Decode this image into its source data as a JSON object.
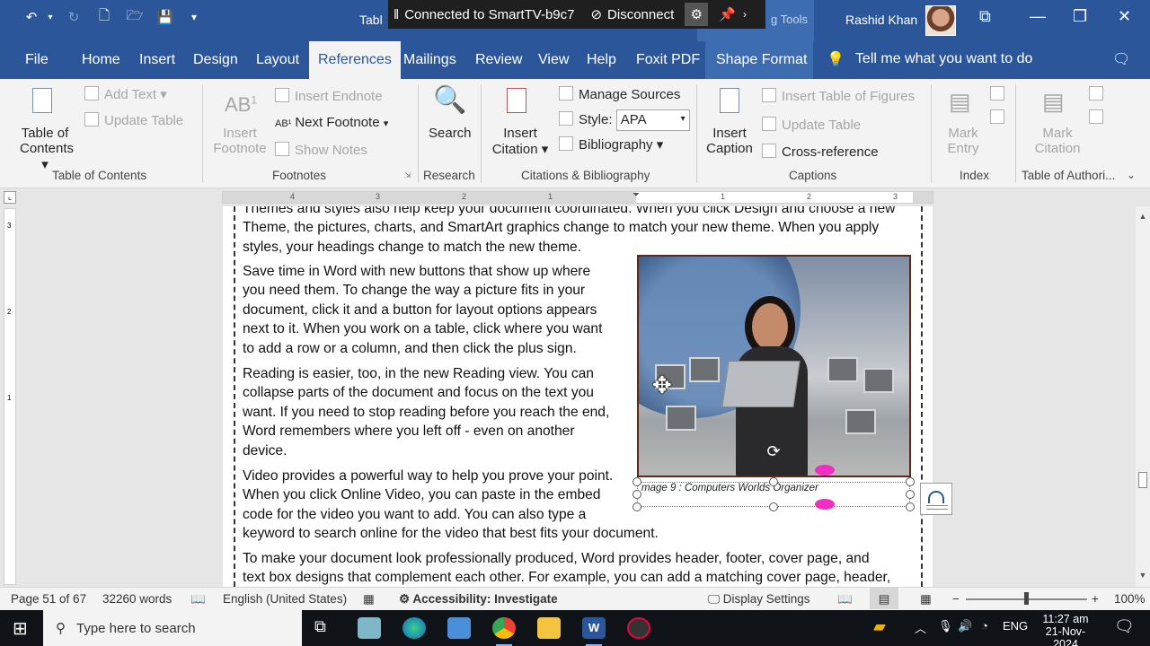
{
  "titlebar": {
    "title_partial": "Tabl",
    "cast": {
      "status": "Connected to SmartTV-b9c7",
      "disconnect": "Disconnect"
    },
    "context_group": "g Tools",
    "user": "Rashid Khan"
  },
  "tabs": [
    "File",
    "Home",
    "Insert",
    "Design",
    "Layout",
    "References",
    "Mailings",
    "Review",
    "View",
    "Help",
    "Foxit PDF",
    "Shape Format"
  ],
  "active_tab": "References",
  "tell_me": "Tell me what you want to do",
  "ribbon": {
    "toc": {
      "table_of_contents": "Table of",
      "table_of_contents_2": "Contents",
      "add_text": "Add Text",
      "update_table": "Update Table",
      "group": "Table of Contents"
    },
    "footnotes": {
      "ab_icon": "AB",
      "insert_footnote": "Insert",
      "insert_footnote_2": "Footnote",
      "insert_endnote": "Insert Endnote",
      "next_footnote": "Next Footnote",
      "show_notes": "Show Notes",
      "group": "Footnotes"
    },
    "research": {
      "search": "Search",
      "group": "Research"
    },
    "citations": {
      "insert_citation": "Insert",
      "insert_citation_2": "Citation",
      "manage_sources": "Manage Sources",
      "style_label": "Style:",
      "style_value": "APA",
      "bibliography": "Bibliography",
      "group": "Citations & Bibliography"
    },
    "captions": {
      "insert_caption": "Insert",
      "insert_caption_2": "Caption",
      "insert_table_of_figures": "Insert Table of Figures",
      "update_table": "Update Table",
      "cross_reference": "Cross-reference",
      "group": "Captions"
    },
    "index": {
      "mark_entry": "Mark",
      "mark_entry_2": "Entry",
      "group": "Index"
    },
    "authorities": {
      "mark_citation": "Mark",
      "mark_citation_2": "Citation",
      "group": "Table of Authori..."
    }
  },
  "ruler": {
    "labels": [
      "4",
      "3",
      "2",
      "1",
      "1",
      "2",
      "3"
    ]
  },
  "vruler": {
    "labels": [
      "3",
      "2",
      "1"
    ]
  },
  "document": {
    "p1_lines": [
      "Themes and styles also help keep your document coordinated. When you click Design and choose a new",
      "Theme, the pictures, charts, and SmartArt graphics change to match your new theme. When you apply",
      "styles, your headings change to match the new theme."
    ],
    "p2_lines": [
      "Save time in Word with new buttons that show up where",
      "you need them. To change the way a picture fits in your",
      "document, click it and a button for layout options appears",
      "next to it. When you work on a table, click where you want",
      "to add a row or a column, and then click the plus sign."
    ],
    "p3_lines": [
      "Reading is easier, too, in the new Reading view. You can",
      "collapse parts of the document and focus on the text you",
      "want. If you need to stop reading before you reach the end,",
      "Word remembers where you left off - even on another",
      "device."
    ],
    "p4_lines": [
      "Video provides a powerful way to help you prove your point.",
      "When you click Online Video, you can paste in the embed",
      "code for the video you want to add. You can also type a",
      "keyword to search online for the video that best fits your document."
    ],
    "p5_lines": [
      "To make your document look professionally produced, Word provides header, footer, cover page, and",
      "text box designs that complement each other. For example, you can add a matching cover page, header,"
    ],
    "caption": "mage 9 : Computers Worlds Organizer"
  },
  "status": {
    "page": "Page 51 of 67",
    "words": "32260 words",
    "language": "English (United States)",
    "accessibility": "Accessibility: Investigate",
    "display_settings": "Display Settings",
    "zoom": "100%"
  },
  "taskbar": {
    "search_placeholder": "Type here to search",
    "lang": "ENG",
    "time": "11:27 am",
    "date": "21-Nov-2024"
  },
  "colors": {
    "word_blue": "#2b579a",
    "ribbon_bg": "#f3f3f3",
    "taskbar": "#101418",
    "selection_pink": "#f02fc2"
  }
}
